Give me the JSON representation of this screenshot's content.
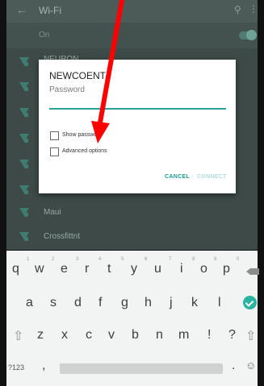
{
  "appbar": {
    "title": "Wi-Fi"
  },
  "onbar": {
    "label": "On"
  },
  "networks": [
    {
      "name": "NEURON"
    },
    {
      "name": ""
    },
    {
      "name": ""
    },
    {
      "name": ""
    },
    {
      "name": ""
    },
    {
      "name": ""
    },
    {
      "name": "Maui"
    },
    {
      "name": "Crossfittnt"
    }
  ],
  "dialog": {
    "title": "NEWCOENT",
    "password_label": "Password",
    "show_password_label": "Show password",
    "advanced_options_label": "Advanced options",
    "cancel_label": "CANCEL",
    "connect_label": "CONNECT"
  },
  "keyboard": {
    "row1": [
      "q",
      "w",
      "e",
      "r",
      "t",
      "y",
      "u",
      "i",
      "o",
      "p"
    ],
    "row1_hints": [
      "1",
      "2",
      "3",
      "4",
      "5",
      "6",
      "7",
      "8",
      "9",
      "0"
    ],
    "row2": [
      "a",
      "s",
      "d",
      "f",
      "g",
      "h",
      "j",
      "k",
      "l"
    ],
    "row3": [
      "z",
      "x",
      "c",
      "v",
      "b",
      "n",
      "m",
      "!",
      "?"
    ],
    "symbols_label": "?123",
    "comma": ",",
    "period": ".",
    "emoji": "☺"
  },
  "colors": {
    "accent": "#1d9e8f",
    "annotation": "#ff0000"
  }
}
